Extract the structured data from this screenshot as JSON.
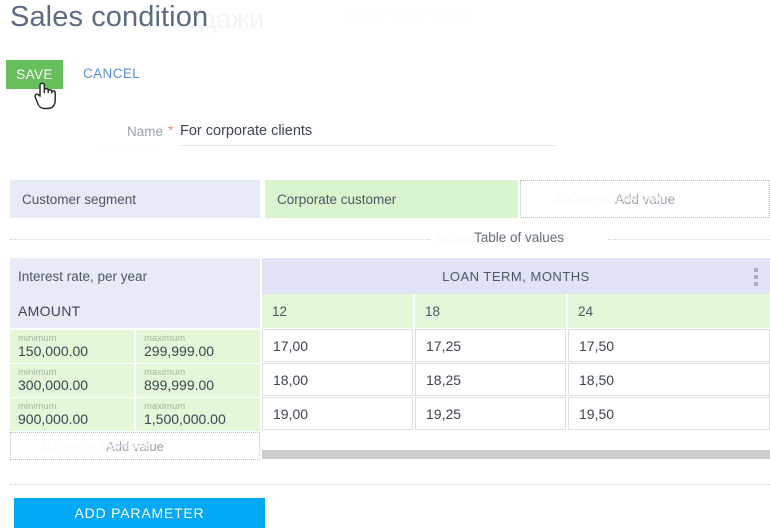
{
  "page": {
    "title": "Sales condition",
    "ghost_title": "одажи",
    "ghost_title_small": "Лучший процент для вас",
    "ghost_sub": "ия"
  },
  "actions": {
    "save_label": "SAVE",
    "cancel_label": "CANCEL",
    "save_color": "#67bf5c",
    "cancel_color": "#5b8dd9",
    "cursor_icon": "pointer-hand-cursor"
  },
  "form": {
    "name_label": "Name",
    "name_required_mark": "*",
    "name_value": "For corporate clients",
    "name_ghost": "Название"
  },
  "parameter_row": {
    "name": "Customer segment",
    "value": "Corporate customer",
    "add_value_label": "Add value",
    "ghost": "Добавить значение",
    "name_bg": "#e7eaf7",
    "value_bg": "#d9f5cd"
  },
  "table_of_values": {
    "divider_label": "Table of values",
    "divider_ghost": "Таблица значений"
  },
  "values_table": {
    "row_axis_label": "Interest rate, per year",
    "column_axis_label": "LOAN TERM, MONTHS",
    "menu_icon": "vertical-ellipsis-icon",
    "amount_header": "AMOUNT",
    "amount_min_caption": "minimum",
    "amount_max_caption": "maximum",
    "term_columns": [
      "12",
      "18",
      "24"
    ],
    "rows": [
      {
        "min": "150,000.00",
        "max": "299,999.00",
        "rates": [
          "17,00",
          "17,25",
          "17,50"
        ]
      },
      {
        "min": "300,000.00",
        "max": "899,999.00",
        "rates": [
          "18,00",
          "18,25",
          "18,50"
        ]
      },
      {
        "min": "900,000.00",
        "max": "1,500,000.00",
        "rates": [
          "19,00",
          "19,25",
          "19,50"
        ]
      }
    ],
    "add_value_label": "Add value",
    "add_value_ghost": "Добавить значение",
    "header_bg": "#e7eaf7",
    "banner_bg": "#dfe3f4",
    "cell_bg": "#e4f7d9",
    "scrollbar_color": "#cccccc"
  },
  "footer": {
    "add_parameter_label": "ADD PARAMETER",
    "add_parameter_color": "#03a9f4"
  }
}
